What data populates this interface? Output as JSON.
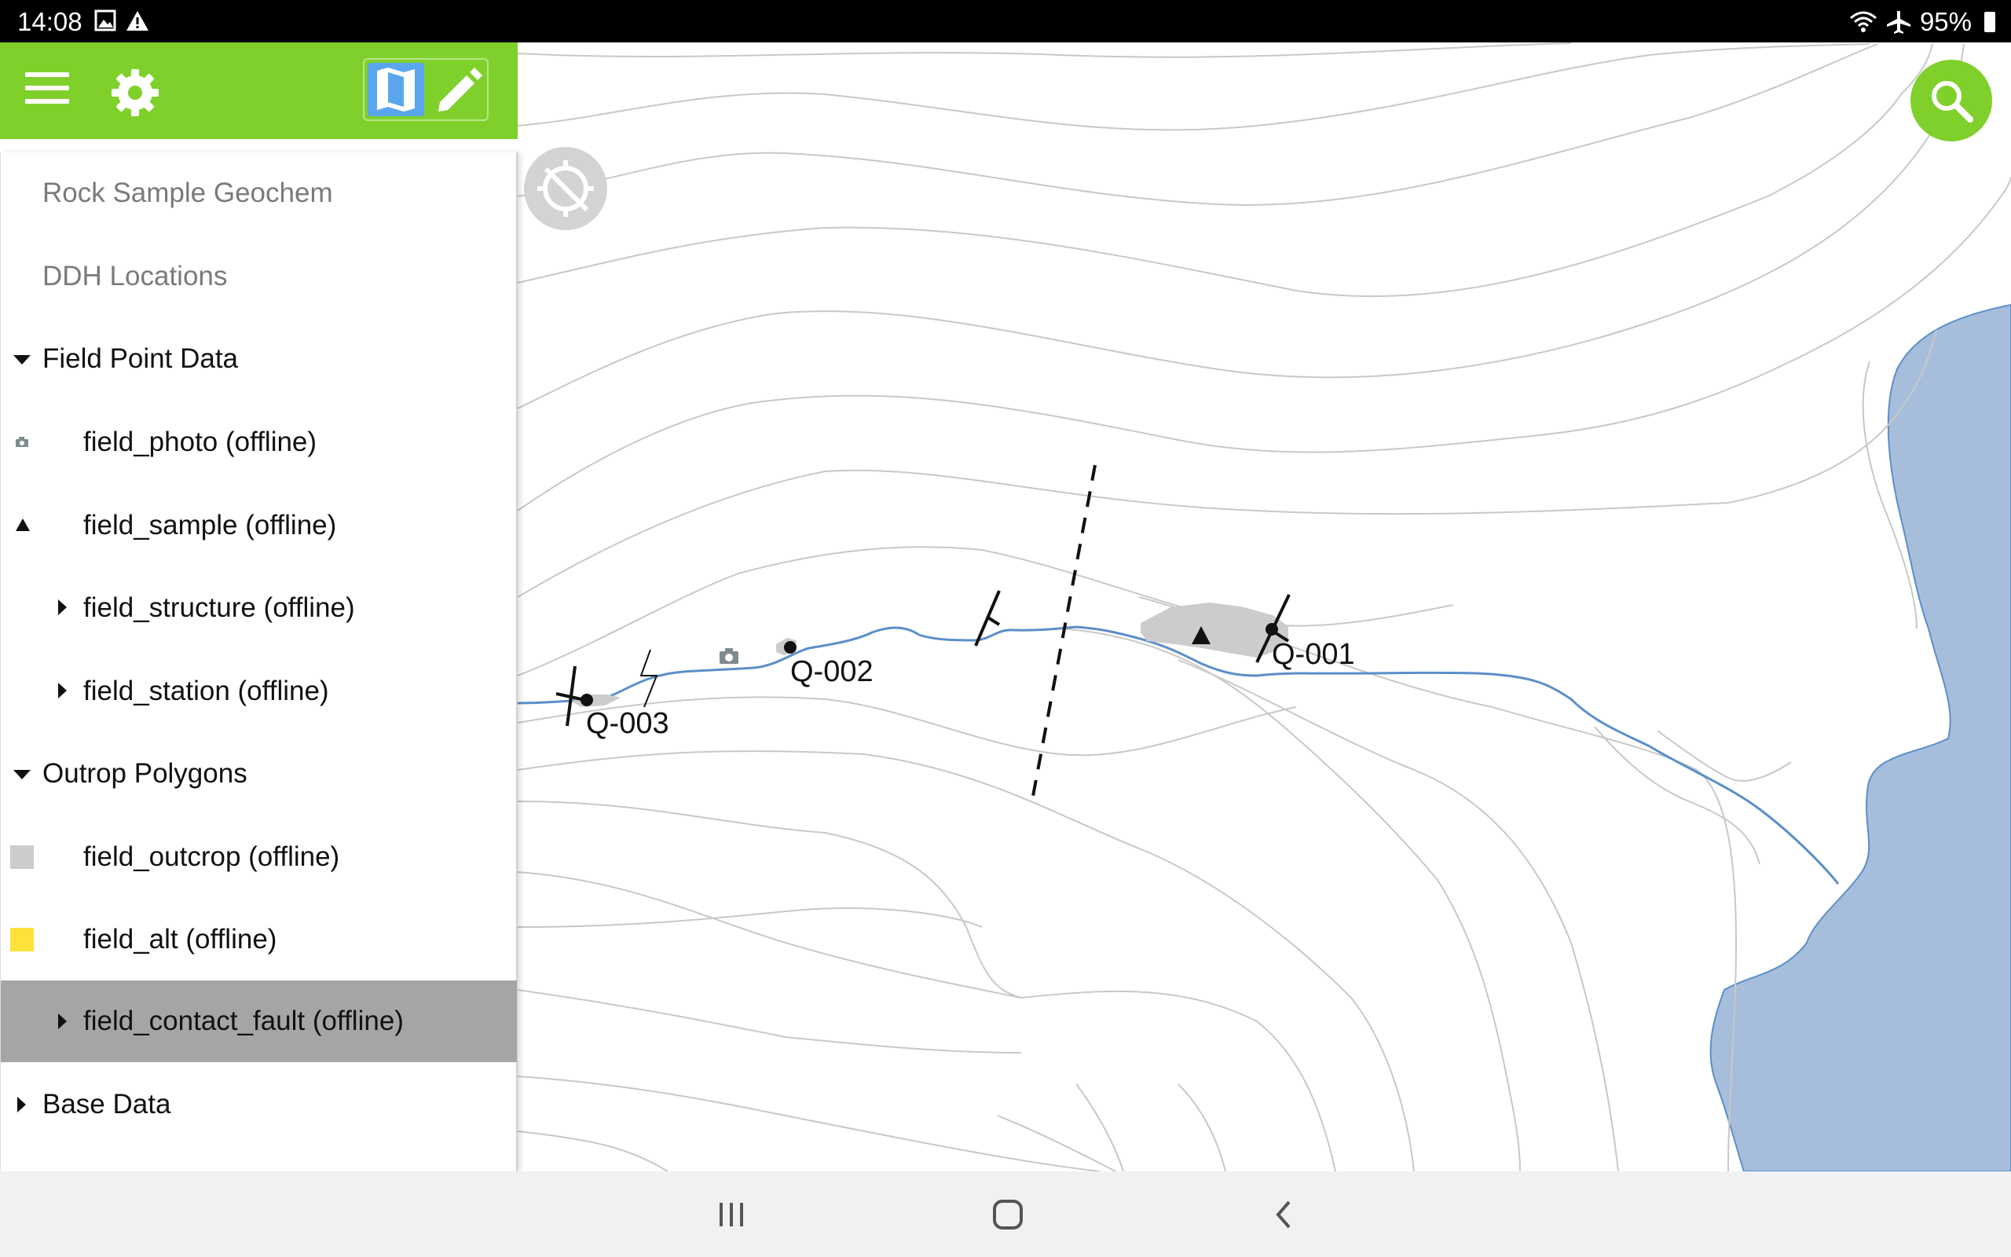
{
  "status_bar": {
    "time": "14:08",
    "left_icons": [
      "image-icon",
      "warning-icon"
    ],
    "right_icons": [
      "wifi-icon",
      "airplane-icon"
    ],
    "battery": "95%"
  },
  "toolbar": {
    "icons": [
      "menu-icon",
      "gear-icon",
      "map-icon",
      "pencil-icon"
    ]
  },
  "layers": [
    {
      "label": "Rock Sample Geochem",
      "indent": 0,
      "expander": "none",
      "symbol": "none",
      "dim": true
    },
    {
      "label": "DDH Locations",
      "indent": 0,
      "expander": "none",
      "symbol": "none",
      "dim": true
    },
    {
      "label": "Field Point Data",
      "indent": 0,
      "expander": "expanded",
      "symbol": "none"
    },
    {
      "label": "field_photo (offline)",
      "indent": 1,
      "expander": "none",
      "symbol": "camera-icon"
    },
    {
      "label": "field_sample (offline)",
      "indent": 1,
      "expander": "none",
      "symbol": "triangle-icon"
    },
    {
      "label": "field_structure (offline)",
      "indent": 1,
      "expander": "collapsed",
      "symbol": "none"
    },
    {
      "label": "field_station (offline)",
      "indent": 1,
      "expander": "collapsed",
      "symbol": "none"
    },
    {
      "label": "Outrop Polygons",
      "indent": 0,
      "expander": "expanded",
      "symbol": "none"
    },
    {
      "label": "field_outcrop (offline)",
      "indent": 1,
      "expander": "none",
      "symbol": "swatch",
      "swatch_color": "#cccccc"
    },
    {
      "label": "field_alt (offline)",
      "indent": 1,
      "expander": "none",
      "symbol": "swatch",
      "swatch_color": "#fde23a"
    },
    {
      "label": "field_contact_fault (offline)",
      "indent": 1,
      "expander": "collapsed",
      "symbol": "none",
      "selected": true
    },
    {
      "label": "Base Data",
      "indent": 0,
      "expander": "collapsed",
      "symbol": "none"
    }
  ],
  "map": {
    "labels": [
      "Q-003",
      "Q-002",
      "Q-001"
    ],
    "icons": [
      "locate-disabled-icon",
      "search-icon"
    ]
  },
  "nav_bar": {
    "icons": [
      "recent-apps-icon",
      "home-icon",
      "back-icon"
    ]
  },
  "colors": {
    "accent_green": "#80d02b",
    "water": "#a6bedc",
    "stream": "#5b8fc9",
    "contour": "#c8c8c8",
    "outcrop": "#cccccc",
    "selected_row": "#a5a5a5"
  }
}
